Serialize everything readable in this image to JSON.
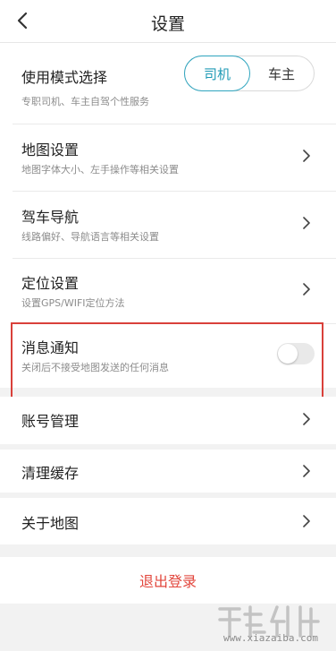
{
  "header": {
    "title": "设置"
  },
  "mode": {
    "title": "使用模式选择",
    "subtitle": "专职司机、车主自驾个性服务",
    "options": [
      "司机",
      "车主"
    ],
    "selected": "司机"
  },
  "settings_rows": [
    {
      "title": "地图设置",
      "subtitle": "地图字体大小、左手操作等相关设置"
    },
    {
      "title": "驾车导航",
      "subtitle": "线路偏好、导航语言等相关设置"
    },
    {
      "title": "定位设置",
      "subtitle": "设置GPS/WIFI定位方法"
    }
  ],
  "notification": {
    "title": "消息通知",
    "subtitle": "关闭后不接受地图发送的任何消息",
    "enabled": false
  },
  "account_rows": [
    {
      "title": "账号管理"
    },
    {
      "title": "清理缓存"
    },
    {
      "title": "关于地图"
    }
  ],
  "logout": {
    "label": "退出登录"
  },
  "watermark": {
    "text": "www.xiazaiba.com"
  },
  "colors": {
    "accent": "#2fa5bf",
    "logout": "#e2463c",
    "highlight": "#d9403a",
    "background": "#f2f2f2"
  }
}
